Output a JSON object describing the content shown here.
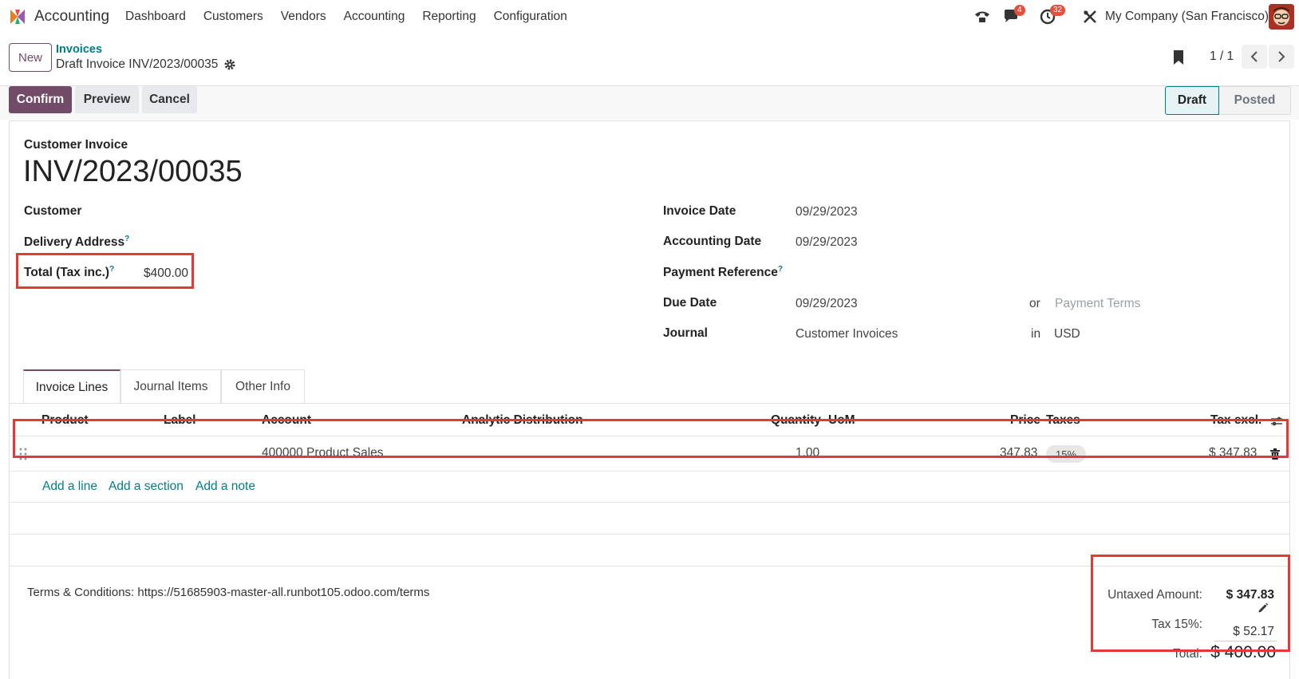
{
  "app": {
    "name": "Accounting"
  },
  "menu": [
    "Dashboard",
    "Customers",
    "Vendors",
    "Accounting",
    "Reporting",
    "Configuration"
  ],
  "systray": {
    "messages_count": "4",
    "activities_count": "32",
    "company": "My Company (San Francisco)"
  },
  "control": {
    "new_label": "New",
    "breadcrumb_parent": "Invoices",
    "breadcrumb_current": "Draft Invoice INV/2023/00035",
    "pager": "1 / 1"
  },
  "actions": {
    "confirm": "Confirm",
    "preview": "Preview",
    "cancel": "Cancel"
  },
  "statusbar": {
    "draft": "Draft",
    "posted": "Posted",
    "active": "Draft"
  },
  "invoice": {
    "type_label": "Customer Invoice",
    "number": "INV/2023/00035",
    "customer_label": "Customer",
    "delivery_label": "Delivery Address",
    "total_label": "Total (Tax inc.)",
    "total_value": "$400.00",
    "help_mark": "?",
    "invoice_date_label": "Invoice Date",
    "invoice_date": "09/29/2023",
    "accounting_date_label": "Accounting Date",
    "accounting_date": "09/29/2023",
    "payment_ref_label": "Payment Reference",
    "due_date_label": "Due Date",
    "due_date": "09/29/2023",
    "or_label": "or",
    "payment_terms_placeholder": "Payment Terms",
    "journal_label": "Journal",
    "journal": "Customer Invoices",
    "in_label": "in",
    "currency": "USD"
  },
  "tabs": [
    "Invoice Lines",
    "Journal Items",
    "Other Info"
  ],
  "lines": {
    "headers": {
      "product": "Product",
      "label": "Label",
      "account": "Account",
      "analytic": "Analytic Distribution",
      "quantity": "Quantity",
      "uom": "UoM",
      "price": "Price",
      "taxes": "Taxes",
      "tax_excl": "Tax excl."
    },
    "rows": [
      {
        "product": "",
        "label": "",
        "account": "400000 Product Sales",
        "analytic": "",
        "quantity": "1.00",
        "uom": "",
        "price": "347.83",
        "tax": "15%",
        "subtotal": "$ 347.83"
      }
    ],
    "add_line": "Add a line",
    "add_section": "Add a section",
    "add_note": "Add a note"
  },
  "terms": "Terms & Conditions: https://51685903-master-all.runbot105.odoo.com/terms",
  "totals": {
    "untaxed_label": "Untaxed Amount:",
    "untaxed": "$ 347.83",
    "tax_label": "Tax 15%:",
    "tax": "$ 52.17",
    "total_label": "Total:",
    "total": "$ 400.00"
  },
  "colors": {
    "primary": "#714b67",
    "link": "#017e84",
    "highlight": "#e53935"
  }
}
